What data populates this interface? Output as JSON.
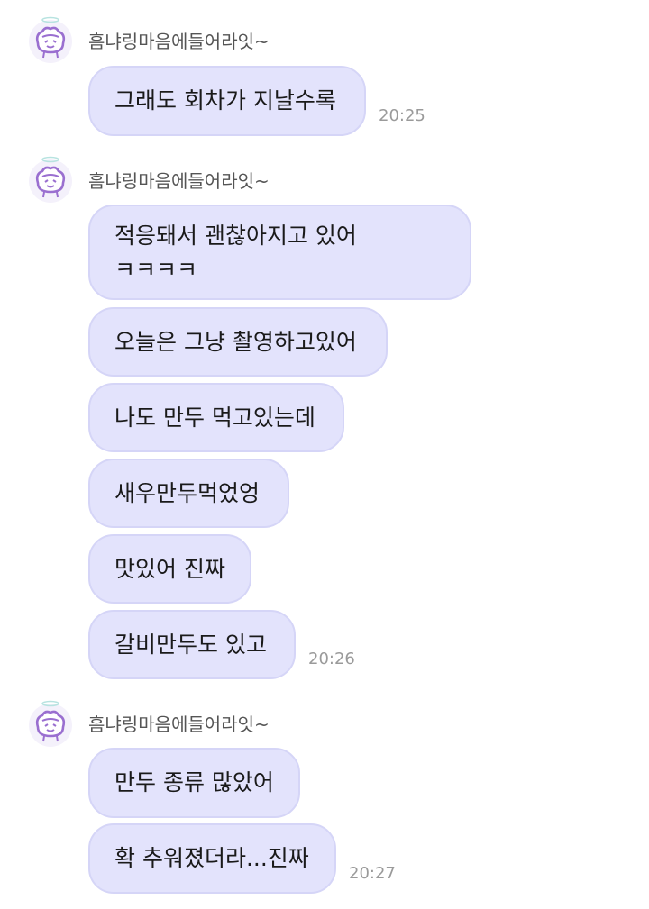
{
  "chat": {
    "groups": [
      {
        "sender": "흠냐링마음에들어라잇~",
        "messages": [
          {
            "text": "그래도 회차가 지날수록"
          }
        ],
        "time": "20:25"
      },
      {
        "sender": "흠냐링마음에들어라잇~",
        "messages": [
          {
            "text": "적응돼서 괜찮아지고 있어\nㅋㅋㅋㅋ"
          },
          {
            "text": "오늘은 그냥 촬영하고있어"
          },
          {
            "text": "나도 만두 먹고있는데"
          },
          {
            "text": "새우만두먹었엉"
          },
          {
            "text": "맛있어 진짜"
          },
          {
            "text": "갈비만두도 있고"
          }
        ],
        "time": "20:26"
      },
      {
        "sender": "흠냐링마음에들어라잇~",
        "messages": [
          {
            "text": "만두 종류 많았어"
          },
          {
            "text": "확 추워졌더라...진짜"
          }
        ],
        "time": "20:27"
      }
    ]
  },
  "colors": {
    "bubble": "#e3e3fc",
    "bubble_border": "#d5d5f7",
    "avatar_accent": "#9a6fd0"
  },
  "icons": {
    "avatar": "angel-character-avatar-icon"
  }
}
